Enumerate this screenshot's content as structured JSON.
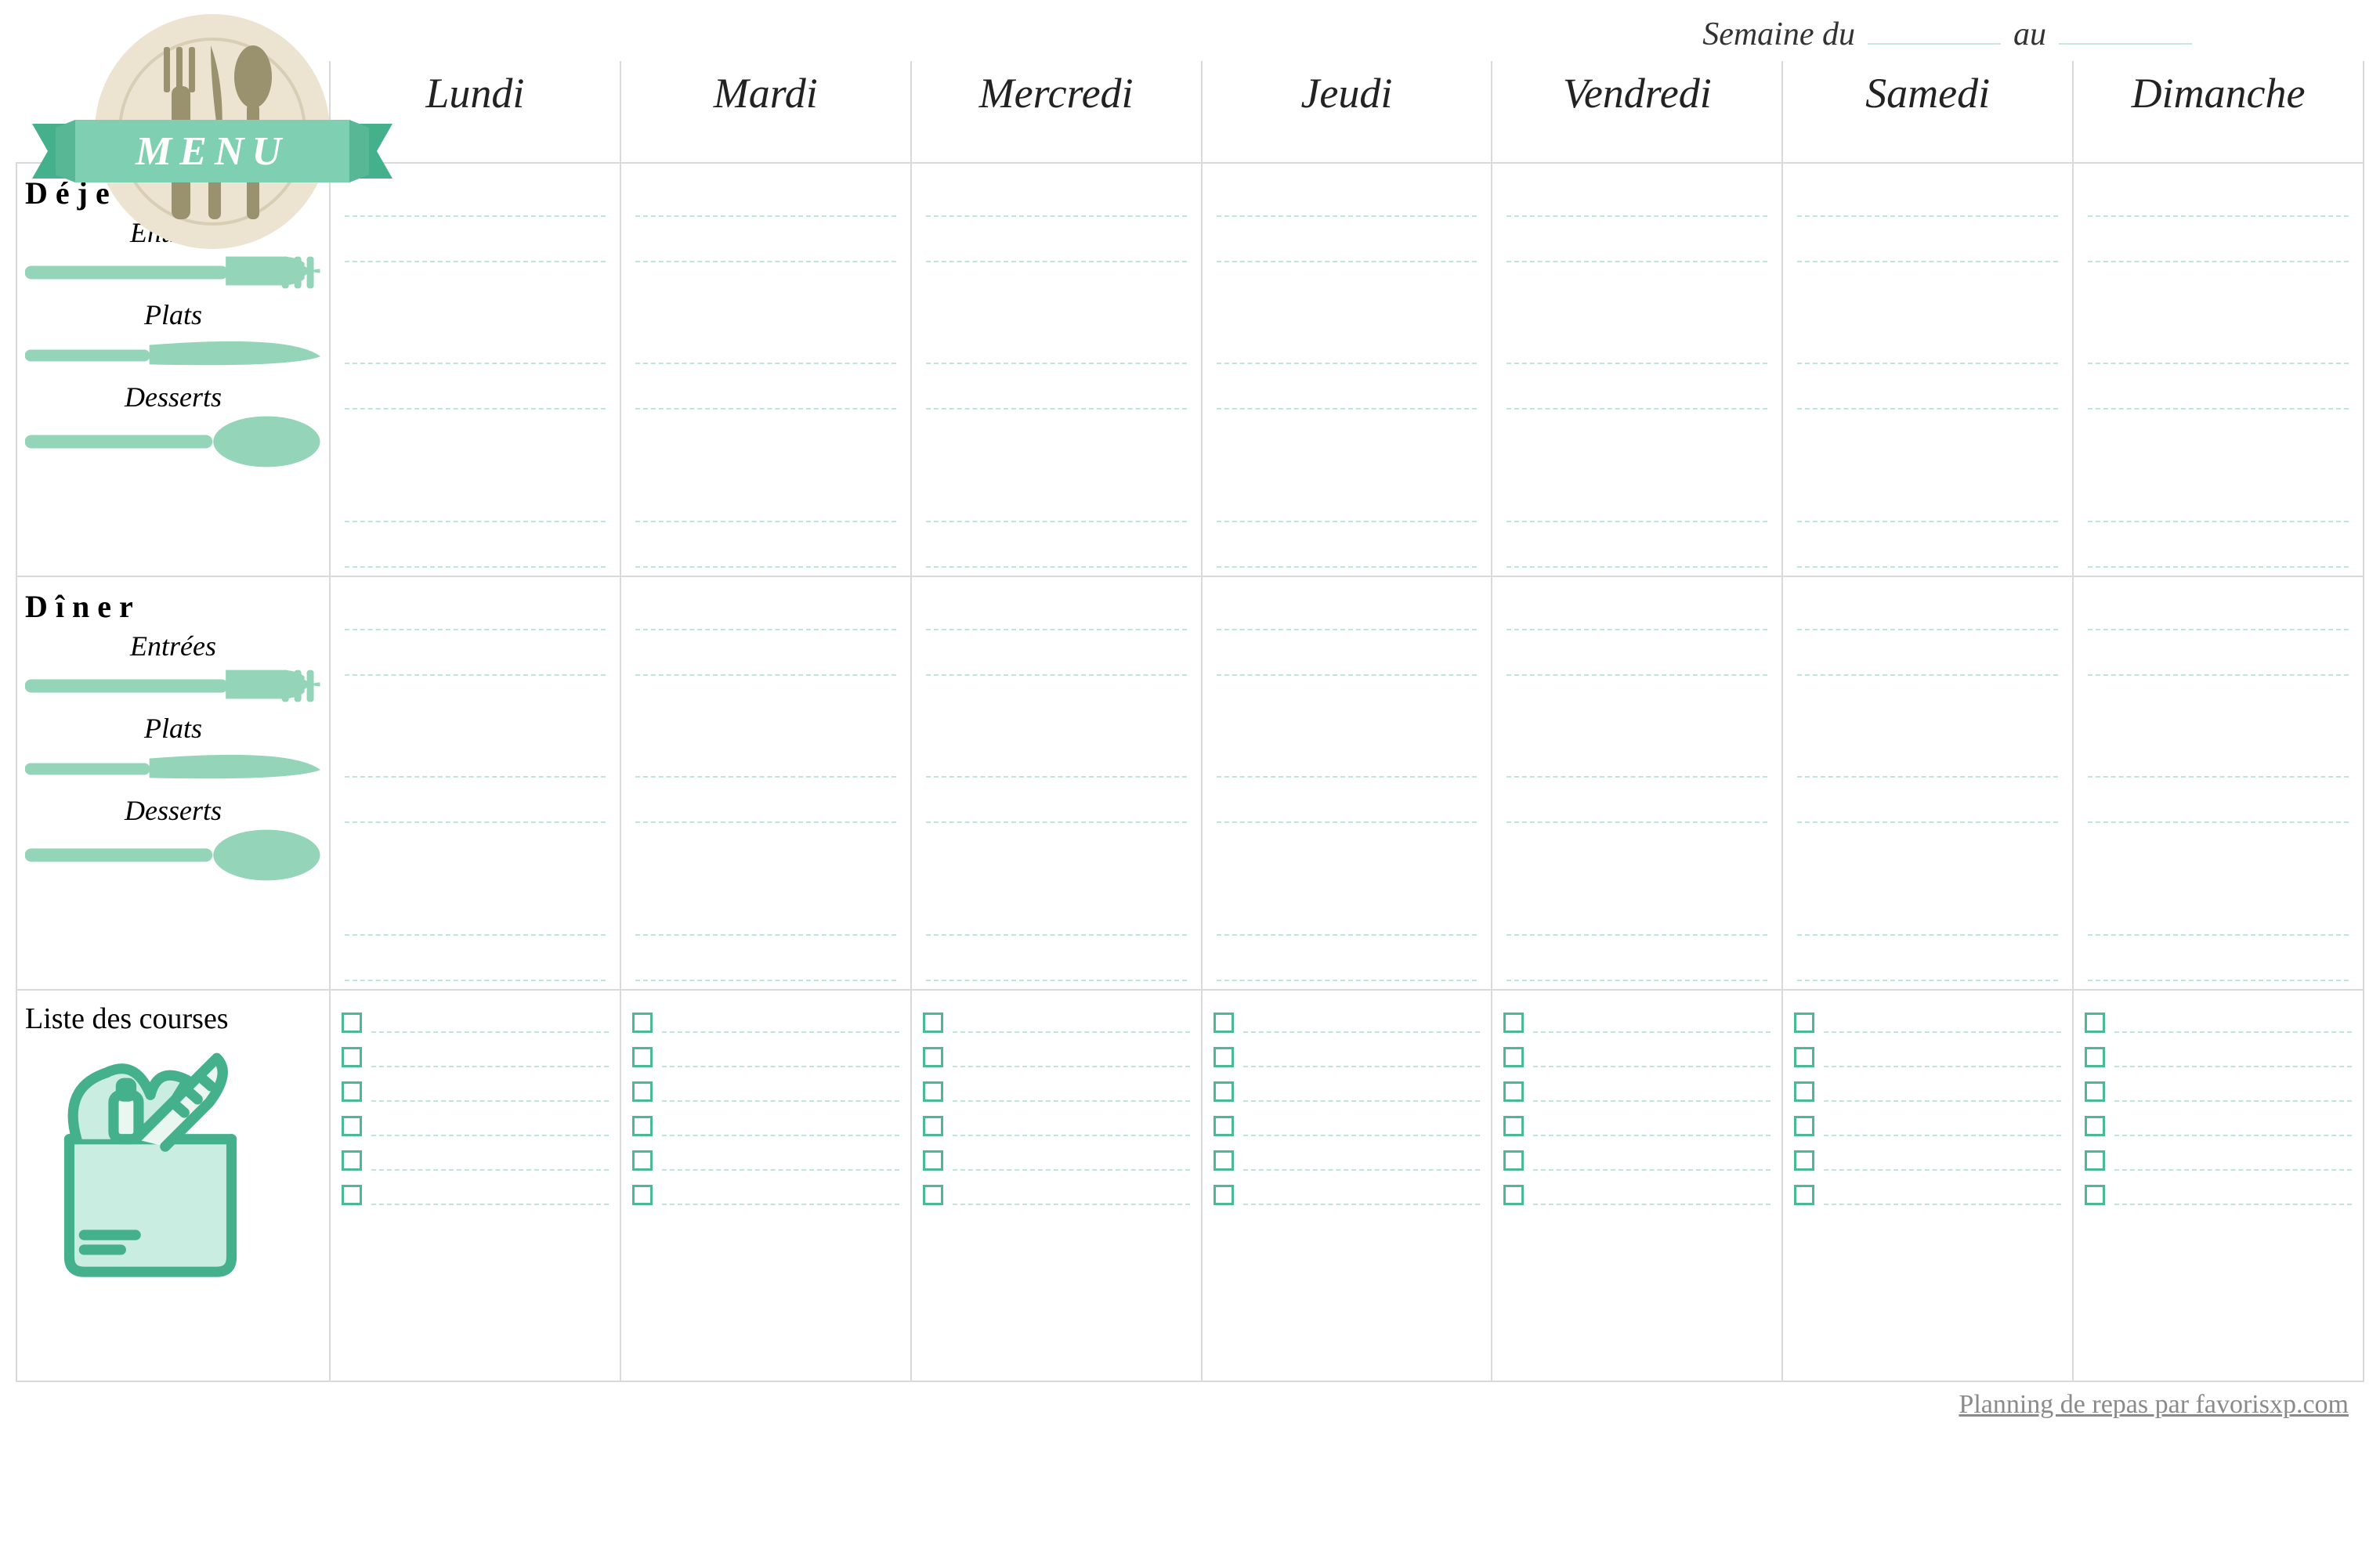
{
  "logo_text": "MENU",
  "week": {
    "prefix": "Semaine du",
    "mid": "au"
  },
  "days": [
    "Lundi",
    "Mardi",
    "Mercredi",
    "Jeudi",
    "Vendredi",
    "Samedi",
    "Dimanche"
  ],
  "meals": {
    "lunch": {
      "title": "Déjeuner",
      "courses": [
        "Entrées",
        "Plats",
        "Desserts"
      ]
    },
    "dinner": {
      "title": "Dîner",
      "courses": [
        "Entrées",
        "Plats",
        "Desserts"
      ]
    }
  },
  "shopping": {
    "title": "Liste des courses",
    "items_per_day": 6
  },
  "footer": "Planning de repas par favorisxp.com",
  "colors": {
    "accent": "#94d4b9",
    "accent_dark": "#45b08c",
    "plate": "#ece3d0"
  }
}
